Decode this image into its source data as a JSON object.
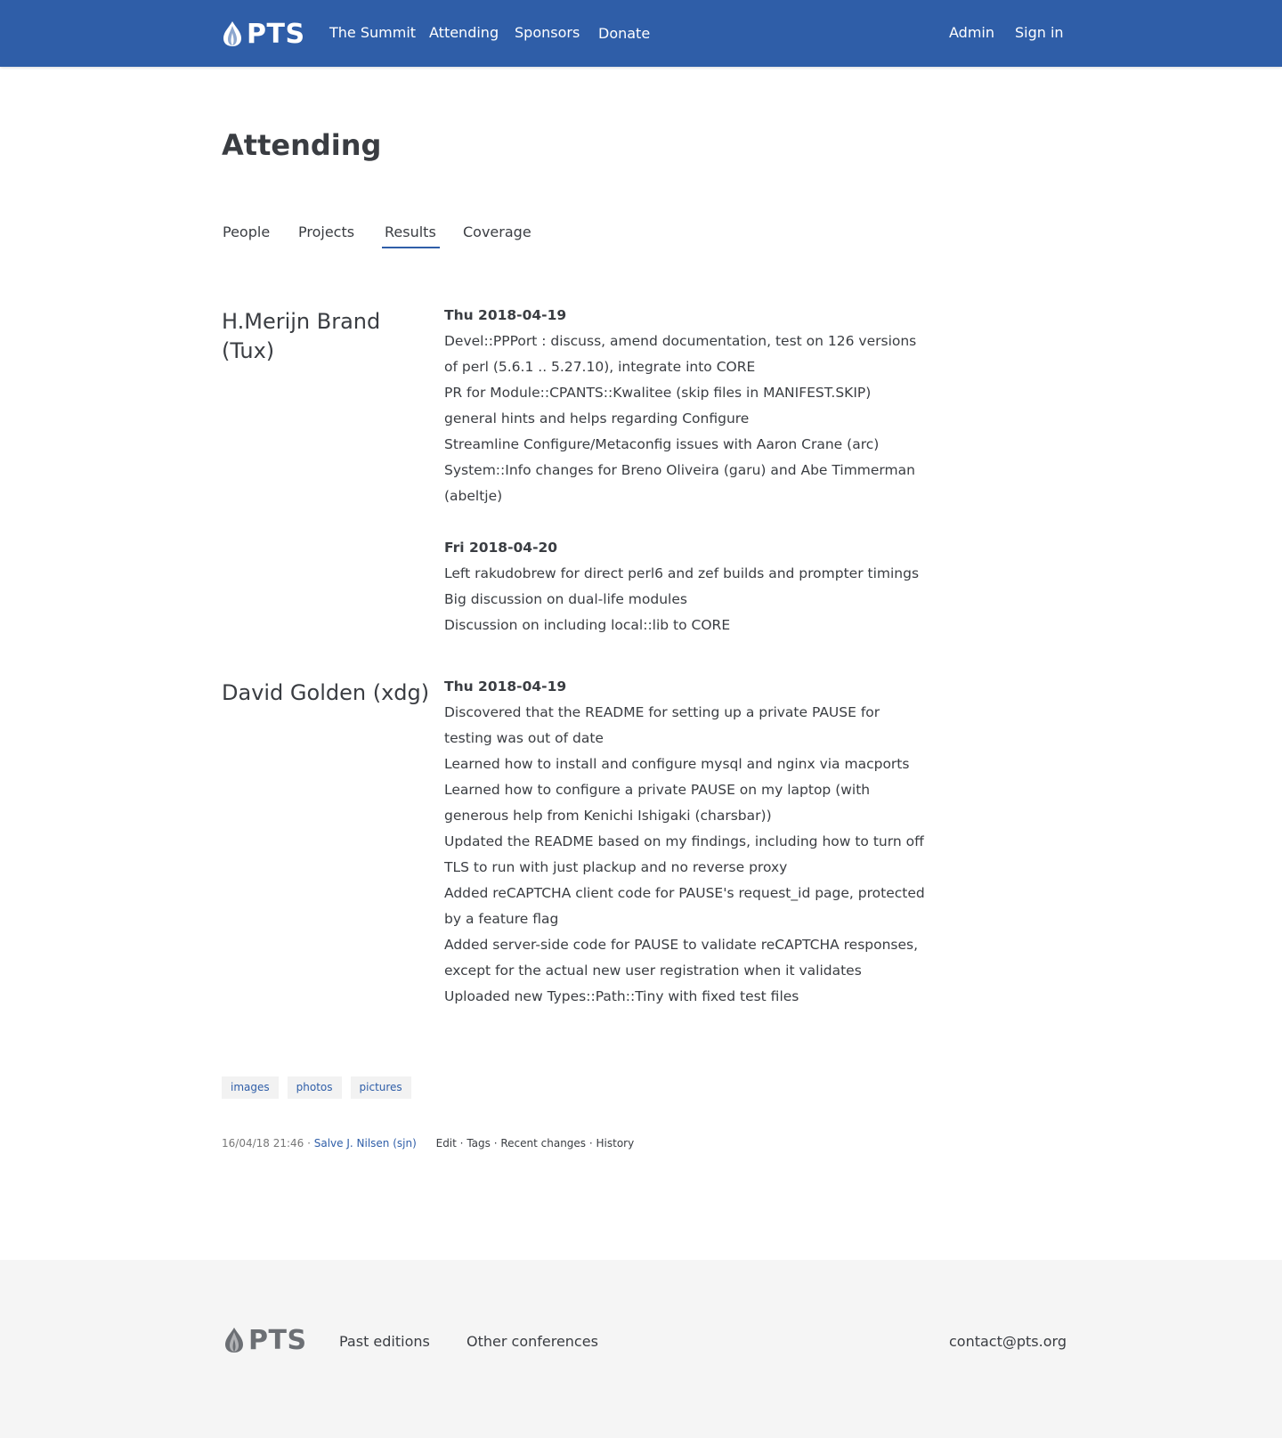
{
  "header": {
    "logo_text": "PTS",
    "nav": [
      "The Summit",
      "Attending",
      "Sponsors",
      "Donate"
    ],
    "admin": "Admin",
    "signin": "Sign in"
  },
  "page": {
    "title": "Attending",
    "tabs": [
      "People",
      "Projects",
      "Results",
      "Coverage"
    ],
    "active_tab": "Results"
  },
  "people": [
    {
      "name": "H.Merijn Brand (Tux)",
      "days": [
        {
          "date": "Thu 2018-04-19",
          "items": [
            "Devel::PPPort : discuss, amend documentation, test on 126 versions of perl (5.6.1 .. 5.27.10), integrate into CORE",
            "PR for Module::CPANTS::Kwalitee (skip files in MANIFEST.SKIP)",
            "general hints and helps regarding Configure",
            "Streamline Configure/Metaconfig issues with Aaron Crane (arc)",
            "System::Info changes for Breno Oliveira (garu) and Abe Timmerman (abeltje)"
          ]
        },
        {
          "date": "Fri 2018-04-20",
          "items": [
            "Left rakudobrew for direct perl6 and zef builds and prompter timings",
            "Big discussion on dual-life modules",
            "Discussion on including local::lib to CORE"
          ]
        }
      ]
    },
    {
      "name": "David Golden (xdg)",
      "days": [
        {
          "date": "Thu 2018-04-19",
          "items": [
            "Discovered that the README for setting up a private PAUSE for testing was out of date",
            "Learned how to install and configure mysql and nginx via macports",
            "Learned how to configure a private PAUSE on my laptop (with generous help from Kenichi Ishigaki (charsbar))",
            "Updated the README based on my findings, including how to turn off TLS to run with just plackup and no reverse proxy",
            "Added reCAPTCHA client code for PAUSE's request_id page, protected by a feature flag",
            "Added server-side code for PAUSE to validate reCAPTCHA responses, except for the actual new user registration when it validates",
            "Uploaded new Types::Path::Tiny with fixed test files"
          ]
        }
      ]
    }
  ],
  "tags": [
    "images",
    "photos",
    "pictures"
  ],
  "meta": {
    "timestamp": "16/04/18 21:46",
    "sep": " · ",
    "author": "Salve J. Nilsen (sjn)",
    "actions": [
      "Edit",
      "Tags",
      "Recent changes",
      "History"
    ]
  },
  "footer": {
    "logo_text": "PTS",
    "links": [
      "Past editions",
      "Other conferences"
    ],
    "contact": "contact@pts.org"
  },
  "colors": {
    "brand_blue": "#2f5ea8",
    "text": "#3a3d42",
    "footer_bg": "#f5f5f5",
    "tag_bg": "#f2f2f2"
  }
}
